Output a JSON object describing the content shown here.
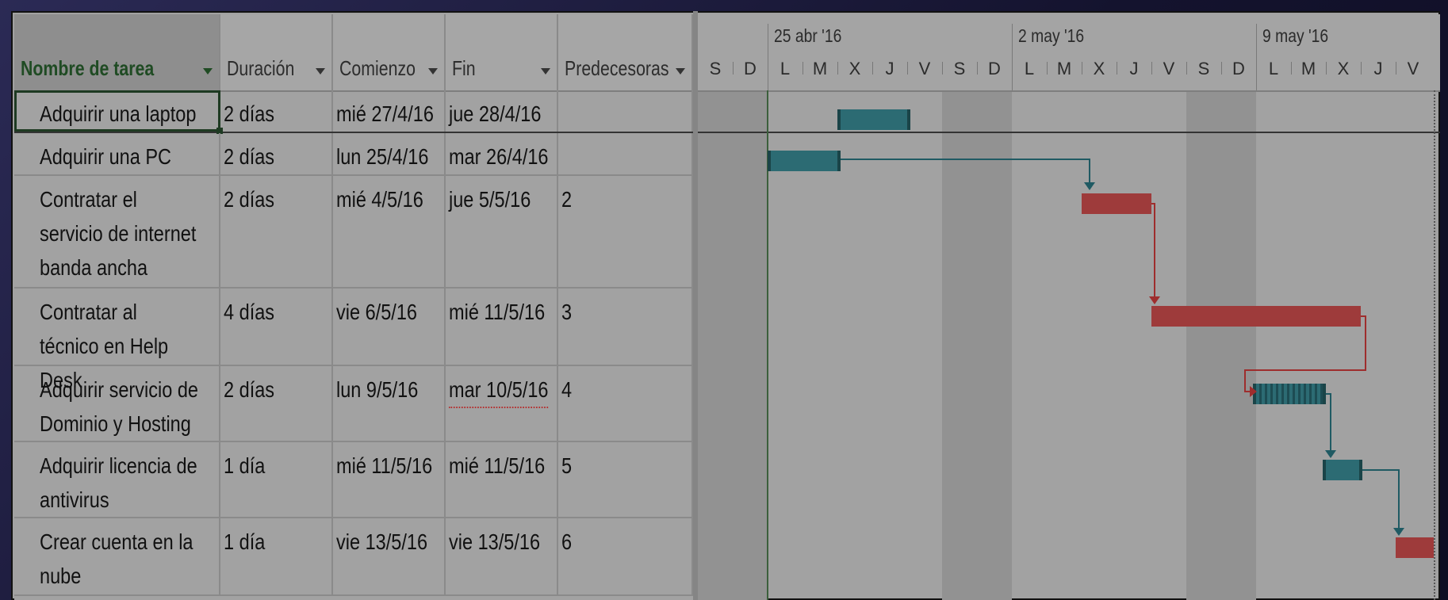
{
  "columns": {
    "name": "Nombre de tarea",
    "duration": "Duración",
    "start": "Comienzo",
    "finish": "Fin",
    "predecessors": "Predecesoras"
  },
  "tasks": [
    {
      "name": "Adquirir una laptop",
      "duration": "2 días",
      "start": "mié 27/4/16",
      "finish": "jue 28/4/16",
      "predecessors": ""
    },
    {
      "name": "Adquirir una PC",
      "duration": "2 días",
      "start": "lun 25/4/16",
      "finish": "mar 26/4/16",
      "predecessors": ""
    },
    {
      "name": "Contratar el servicio de internet banda ancha",
      "duration": "2 días",
      "start": "mié 4/5/16",
      "finish": "jue 5/5/16",
      "predecessors": "2"
    },
    {
      "name": "Contratar al técnico en Help Desk",
      "duration": "4 días",
      "start": "vie 6/5/16",
      "finish": "mié 11/5/16",
      "predecessors": "3"
    },
    {
      "name": "Adquirir servicio de Dominio y Hosting",
      "duration": "2 días",
      "start": "lun 9/5/16",
      "finish": "mar 10/5/16",
      "predecessors": "4"
    },
    {
      "name": "Adquirir licencia de antivirus",
      "duration": "1 día",
      "start": "mié 11/5/16",
      "finish": "mié 11/5/16",
      "predecessors": "5"
    },
    {
      "name": "Crear cuenta en la nube",
      "duration": "1 día",
      "start": "vie 13/5/16",
      "finish": "vie 13/5/16",
      "predecessors": "6"
    }
  ],
  "timescale": {
    "weeks": [
      "25 abr '16",
      "2 may '16",
      "9 may '16"
    ],
    "days": [
      "S",
      "D",
      "L",
      "M",
      "X",
      "J",
      "V",
      "S",
      "D",
      "L",
      "M",
      "X",
      "J",
      "V",
      "S",
      "D",
      "L",
      "M",
      "X",
      "J",
      "V"
    ]
  },
  "colors": {
    "normal_task": "#2c6b73",
    "critical_task": "#9e3b3b",
    "name_header": "#1f4b23"
  },
  "icons": {
    "sort": "chevron-down-icon",
    "link_arrow": "arrow-head-icon"
  }
}
